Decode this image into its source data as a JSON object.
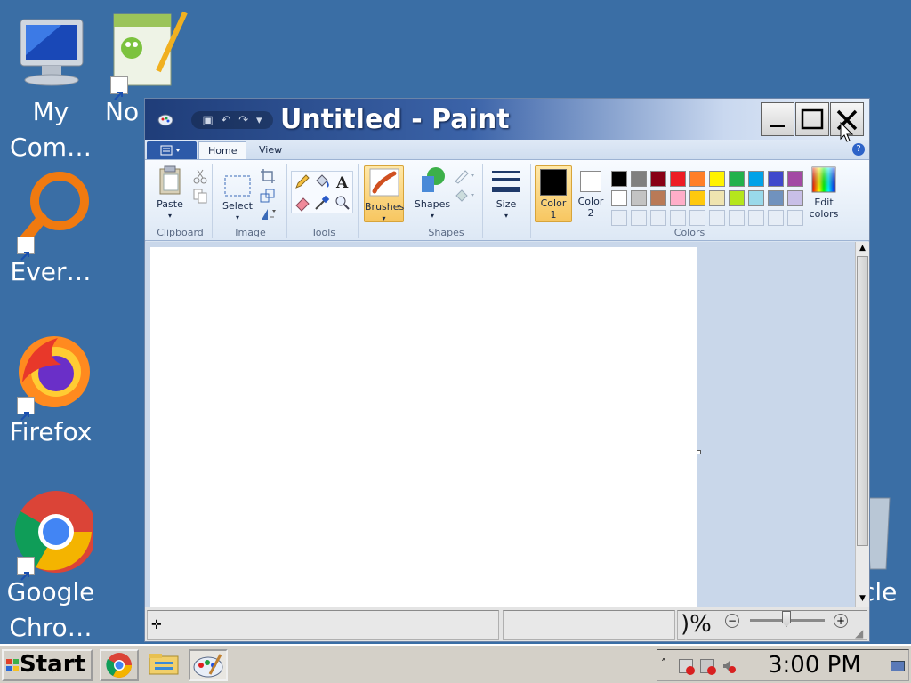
{
  "desktop": {
    "icons": [
      {
        "label": "My\nCom…",
        "icon": "computer-icon"
      },
      {
        "label": "No",
        "icon": "notepadpp-icon"
      },
      {
        "label": "Ever…",
        "icon": "everything-search-icon"
      },
      {
        "label": "Firefox",
        "icon": "firefox-icon"
      },
      {
        "label": "Google\nChro…",
        "icon": "chrome-icon"
      },
      {
        "label": "cle",
        "icon": "recycle-bin-icon"
      }
    ]
  },
  "window": {
    "title": "Untitled - Paint",
    "tabs": [
      "Home",
      "View"
    ],
    "active_tab": "Home",
    "ribbon": {
      "clipboard": {
        "label": "Clipboard",
        "paste": "Paste"
      },
      "image": {
        "label": "Image",
        "select": "Select"
      },
      "tools": {
        "label": "Tools"
      },
      "brushes": {
        "label": "Brushes"
      },
      "shapes": {
        "label": "Shapes",
        "button": "Shapes"
      },
      "size": {
        "label": "Size"
      },
      "colors": {
        "label": "Colors",
        "color1": "Color\n1",
        "color2": "Color\n2",
        "edit": "Edit\ncolors",
        "color1_value": "#000000",
        "color2_value": "#ffffff",
        "palette_row1": [
          "#000000",
          "#7f7f7f",
          "#880015",
          "#ed1c24",
          "#ff7f27",
          "#fff200",
          "#22b14c",
          "#00a2e8",
          "#3f48cc",
          "#a349a4"
        ],
        "palette_row2": [
          "#ffffff",
          "#c3c3c3",
          "#b97a57",
          "#ffaec9",
          "#ffc90e",
          "#efe4b0",
          "#b5e61d",
          "#99d9ea",
          "#7092be",
          "#c8bfe7"
        ]
      }
    },
    "status": {
      "zoom_text": ")%"
    }
  },
  "taskbar": {
    "start_label": "Start",
    "apps": [
      "chrome-icon",
      "file-explorer-icon",
      "paint-icon"
    ],
    "clock": "3:00 PM"
  }
}
